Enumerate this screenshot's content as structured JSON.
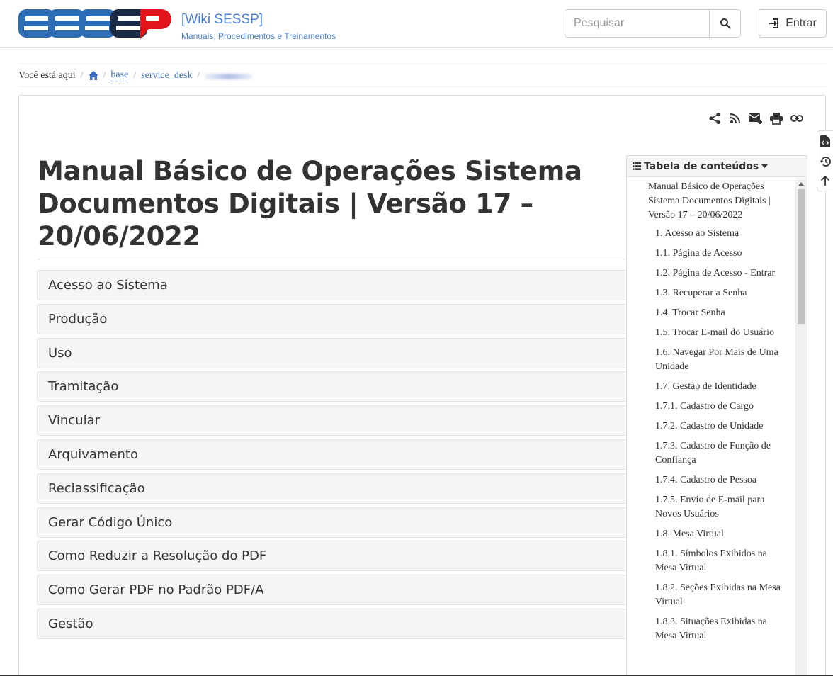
{
  "site": {
    "title": "[Wiki SESSP]",
    "tagline": "Manuais, Procedimentos e Treinamentos",
    "logo_text": "SESSP",
    "colors": {
      "accent": "#4a7fd6",
      "logo_blue": "#2d6db5",
      "logo_red": "#e1141b"
    }
  },
  "search": {
    "placeholder": "Pesquisar",
    "value": "",
    "button_icon": "search-icon"
  },
  "login": {
    "label": "Entrar",
    "icon": "login-icon"
  },
  "breadcrumb": {
    "label": "Você está aqui",
    "home_icon": "home-icon",
    "items": [
      "base",
      "service_desk"
    ]
  },
  "page_tools": [
    "share-icon",
    "rss-icon",
    "email-plus-icon",
    "print-icon",
    "link-icon"
  ],
  "side_tools": [
    "file-code-icon",
    "history-icon",
    "arrow-up-icon"
  ],
  "page": {
    "title": "Manual Básico de Operações Sistema Documentos Digitais | Versão 17 – 20/06/2022",
    "sections": [
      "Acesso ao Sistema",
      "Produção",
      "Uso",
      "Tramitação",
      "Vincular",
      "Arquivamento",
      "Reclassificação",
      "Gerar Código Único",
      "Como Reduzir a Resolução do PDF",
      "Como Gerar PDF no Padrão PDF/A",
      "Gestão"
    ]
  },
  "toc": {
    "header": "Tabela de conteúdos",
    "items": [
      {
        "level": 0,
        "text": "Manual Básico de Operações Sistema Documentos Digitais | Versão 17 – 20/06/2022"
      },
      {
        "level": 1,
        "text": "1. Acesso ao Sistema"
      },
      {
        "level": 1,
        "text": "1.1. Página de Acesso"
      },
      {
        "level": 1,
        "text": "1.2. Página de Acesso - Entrar"
      },
      {
        "level": 1,
        "text": "1.3. Recuperar a Senha"
      },
      {
        "level": 1,
        "text": "1.4. Trocar Senha"
      },
      {
        "level": 1,
        "text": "1.5. Trocar E-mail do Usuário"
      },
      {
        "level": 1,
        "text": "1.6. Navegar Por Mais de Uma Unidade"
      },
      {
        "level": 1,
        "text": "1.7. Gestão de Identidade"
      },
      {
        "level": 1,
        "text": "1.7.1. Cadastro de Cargo"
      },
      {
        "level": 1,
        "text": "1.7.2. Cadastro de Unidade"
      },
      {
        "level": 1,
        "text": "1.7.3. Cadastro de Função de Confiança"
      },
      {
        "level": 1,
        "text": "1.7.4. Cadastro de Pessoa"
      },
      {
        "level": 1,
        "text": "1.7.5. Envio de E-mail para Novos Usuários"
      },
      {
        "level": 1,
        "text": "1.8. Mesa Virtual"
      },
      {
        "level": 1,
        "text": "1.8.1. Símbolos Exibidos na Mesa Virtual"
      },
      {
        "level": 1,
        "text": "1.8.2. Seções Exibidas na Mesa Virtual"
      },
      {
        "level": 1,
        "text": "1.8.3. Situações Exibidas na Mesa Virtual"
      }
    ]
  }
}
